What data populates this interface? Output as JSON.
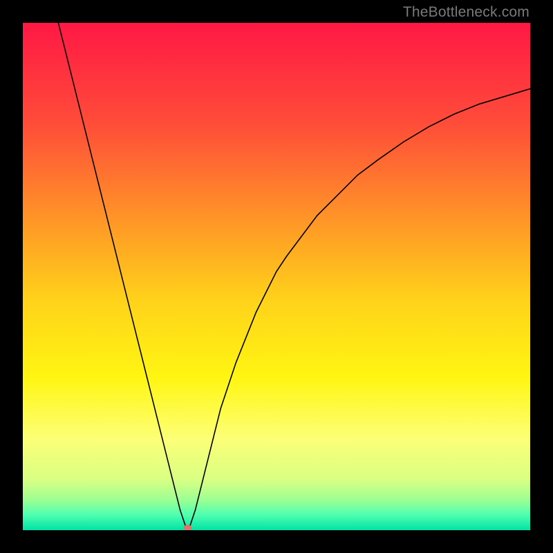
{
  "watermark": "TheBottleneck.com",
  "chart_data": {
    "type": "line",
    "title": "",
    "xlabel": "",
    "ylabel": "",
    "xlim": [
      0,
      100
    ],
    "ylim": [
      0,
      100
    ],
    "grid": false,
    "series": [
      {
        "name": "curve",
        "color": "#000000",
        "x": [
          7,
          8,
          9,
          10,
          11,
          12,
          13,
          14,
          15,
          16,
          17,
          18,
          19,
          20,
          21,
          22,
          23,
          24,
          25,
          26,
          27,
          28,
          29,
          30,
          31,
          32,
          32.5,
          33,
          34,
          35,
          36,
          37,
          38,
          39,
          40,
          42,
          44,
          46,
          48,
          50,
          52,
          55,
          58,
          62,
          66,
          70,
          75,
          80,
          85,
          90,
          95,
          100
        ],
        "y": [
          100,
          96,
          92,
          88,
          84,
          80,
          76,
          72,
          68,
          64,
          60,
          56,
          52,
          48,
          44,
          40,
          36,
          32,
          28,
          24,
          20,
          16,
          12,
          8,
          4,
          1,
          0.5,
          1,
          4,
          8,
          12,
          16,
          20,
          24,
          27,
          33,
          38,
          43,
          47,
          51,
          54,
          58,
          62,
          66,
          70,
          73,
          76.5,
          79.5,
          82,
          84,
          85.5,
          87
        ]
      }
    ],
    "marker": {
      "x": 32.5,
      "y": 0.5,
      "color": "#e37169",
      "rx": 6,
      "ry": 4
    },
    "background_gradient": {
      "stops": [
        {
          "offset": 0.0,
          "color": "#ff1845"
        },
        {
          "offset": 0.2,
          "color": "#ff4d39"
        },
        {
          "offset": 0.4,
          "color": "#ff9a26"
        },
        {
          "offset": 0.55,
          "color": "#ffd31a"
        },
        {
          "offset": 0.7,
          "color": "#fff612"
        },
        {
          "offset": 0.82,
          "color": "#fdff77"
        },
        {
          "offset": 0.9,
          "color": "#d9ff83"
        },
        {
          "offset": 0.94,
          "color": "#9dff93"
        },
        {
          "offset": 0.97,
          "color": "#4effb0"
        },
        {
          "offset": 1.0,
          "color": "#00e2a6"
        }
      ]
    }
  }
}
